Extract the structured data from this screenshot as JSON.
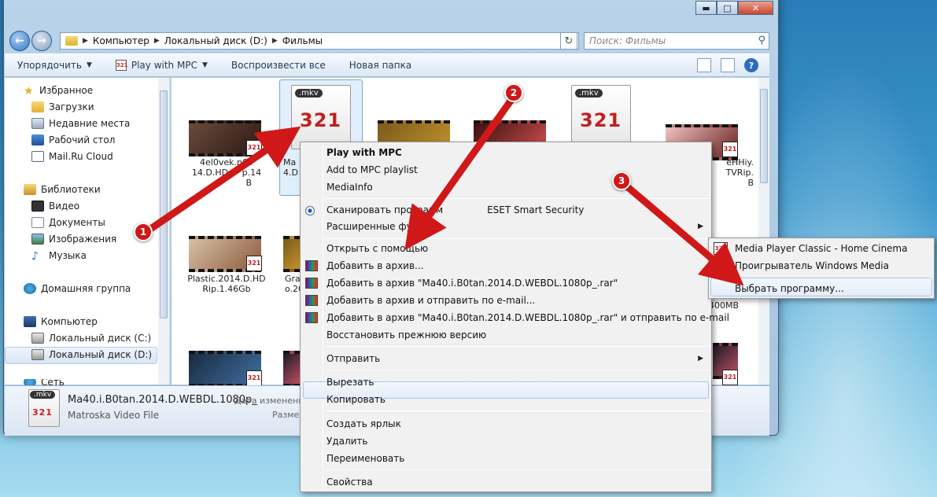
{
  "window": {
    "caption_buttons": {
      "minimize": "▬",
      "maximize": "□",
      "close": "✕"
    }
  },
  "address_bar": {
    "crumbs": [
      "Компьютер",
      "Локальный диск (D:)",
      "Фильмы"
    ],
    "search_placeholder": "Поиск: Фильмы"
  },
  "toolbar": {
    "organize": "Упорядочить",
    "play_with_mpc": "Play with MPC",
    "play_all": "Воспроизвести все",
    "new_folder": "Новая папка"
  },
  "sidebar": {
    "items": [
      {
        "label": "Избранное",
        "icon": "star-icon"
      },
      {
        "label": "Загрузки",
        "icon": "downloads-icon"
      },
      {
        "label": "Недавние места",
        "icon": "recent-places-icon"
      },
      {
        "label": "Рабочий стол",
        "icon": "desktop-icon"
      },
      {
        "label": "Mail.Ru Cloud",
        "icon": "cloud-icon"
      },
      {
        "label": "Библиотеки",
        "icon": "libraries-icon"
      },
      {
        "label": "Видео",
        "icon": "video-icon"
      },
      {
        "label": "Документы",
        "icon": "documents-icon"
      },
      {
        "label": "Изображения",
        "icon": "pictures-icon"
      },
      {
        "label": "Музыка",
        "icon": "music-icon"
      },
      {
        "label": "Домашняя группа",
        "icon": "homegroup-icon"
      },
      {
        "label": "Компьютер",
        "icon": "computer-icon"
      },
      {
        "label": "Локальный диск (C:)",
        "icon": "drive-icon"
      },
      {
        "label": "Локальный диск (D:)",
        "icon": "drive-icon"
      },
      {
        "label": "Сеть",
        "icon": "network-icon"
      }
    ]
  },
  "files": {
    "f1": {
      "line1": "4el0vek.n09",
      "line2": "14.D.HD",
      "line3": "p.14",
      "line4": "B"
    },
    "f2": {
      "ext": ".mkv",
      "line1": "Ma",
      "line2": "4.D"
    },
    "f3": {
      "line1": "Plastic.2014.D.HD",
      "line2": "Rip.1.46Gb"
    },
    "f4": {
      "line1": "Gra",
      "line2": "o.20"
    },
    "f5": {
      "ext": ".mkv"
    },
    "f6": {
      "line1": "eHHiy.",
      "line2": "TVRip.",
      "line3": "B"
    },
    "f7": {
      "line1": "400MB"
    },
    "badge": "321"
  },
  "details": {
    "ext": ".mkv",
    "name": "Ma40.i.B0tan.2014.D.WEBDL.1080p_",
    "date_label": "Дата изменени",
    "type": "Matroska Video File",
    "size_label": "Разме"
  },
  "context_menu": {
    "play": "Play with MPC",
    "add_playlist": "Add to MPC playlist",
    "mediainfo": "MediaInfo",
    "scan": "Сканировать программ",
    "scan_rest": "ESET Smart Security",
    "advanced": "Расширенные функ",
    "open_with": "Открыть с помощью",
    "add_archive": "Добавить в архив...",
    "add_rar": "Добавить в архив \"Ma40.i.B0tan.2014.D.WEBDL.1080p_.rar\"",
    "add_email": "Добавить в архив и отправить по e-mail...",
    "add_rar_email": "Добавить в архив \"Ma40.i.B0tan.2014.D.WEBDL.1080p_.rar\" и отправить по e-mail",
    "restore": "Восстановить прежнюю версию",
    "send_to": "Отправить",
    "cut": "Вырезать",
    "copy": "Копировать",
    "shortcut": "Создать ярлык",
    "delete": "Удалить",
    "rename": "Переименовать",
    "properties": "Свойства"
  },
  "submenu": {
    "mpc": "Media Player Classic - Home Cinema",
    "wmp": "Проигрыватель Windows Media",
    "choose": "Выбрать программу..."
  },
  "annotations": {
    "n1": "1",
    "n2": "2",
    "n3": "3",
    "arrow_color": "#d01818"
  }
}
